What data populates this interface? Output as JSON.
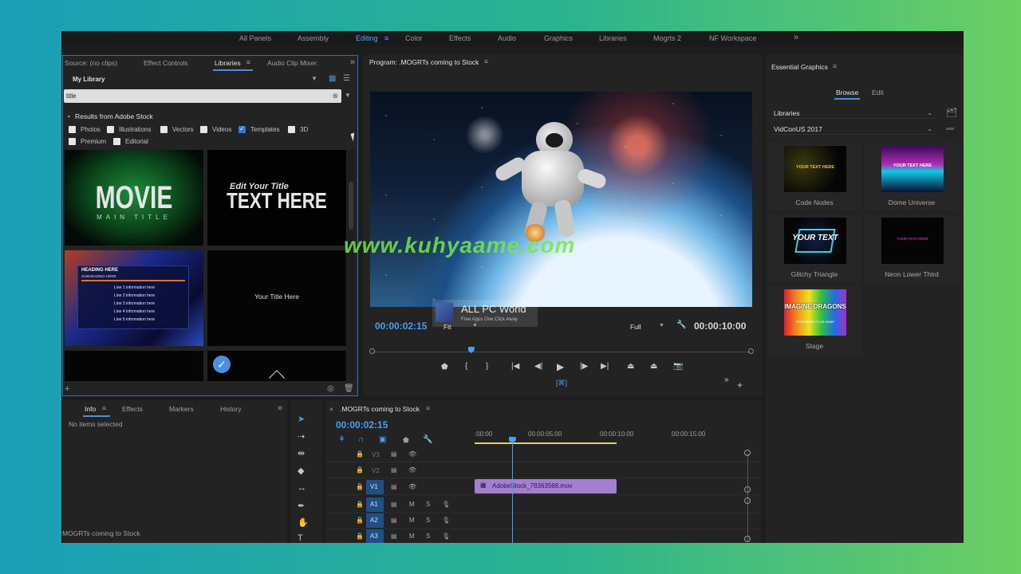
{
  "workspaces": {
    "items": [
      "All Panels",
      "Assembly",
      "Editing",
      "Color",
      "Effects",
      "Audio",
      "Graphics",
      "Libraries",
      "Mogrts 2",
      "NF Workspace"
    ],
    "active": "Editing",
    "more_icon": "chevron-double-right-icon"
  },
  "source_panel": {
    "tabs": [
      "Source: (no clips)",
      "Effect Controls",
      "Libraries",
      "Audio Clip Mixer:"
    ],
    "active_tab": "Libraries",
    "library_select": "My Library",
    "search": {
      "value": "title",
      "placeholder": ""
    },
    "results_header": "Results from Adobe Stock",
    "filters": [
      {
        "label": "Photos",
        "checked": false
      },
      {
        "label": "Illustrations",
        "checked": false
      },
      {
        "label": "Vectors",
        "checked": false
      },
      {
        "label": "Videos",
        "checked": false
      },
      {
        "label": "Templates",
        "checked": true
      },
      {
        "label": "3D",
        "checked": false
      },
      {
        "label": "Premium",
        "checked": false
      },
      {
        "label": "Editorial",
        "checked": false
      }
    ],
    "tiles": {
      "movie_main": "MOVIE",
      "movie_sub": "MAIN TITLE",
      "edit_small": "Edit Your Title",
      "edit_big": "TEXT HERE",
      "heading": "HEADING HERE",
      "subheading": "SUBHEADING HERE",
      "lines": [
        "Line 1 information here",
        "Line 2 information here",
        "Line 3 information here",
        "Line 4 information here",
        "Line 5 information here"
      ],
      "your_title": "Your Title Here"
    }
  },
  "program": {
    "title": "Program: .MOGRTs coming to Stock",
    "timecode_current": "00:00:02:15",
    "fit": "Fit",
    "quality": "Full",
    "timecode_total": "00:00:10:00",
    "playhead_fraction": 0.26
  },
  "essential_graphics": {
    "title": "Essential Graphics",
    "tabs": [
      "Browse",
      "Edit"
    ],
    "active_tab": "Browse",
    "dropdown1": "Libraries",
    "dropdown2": "VidConUS 2017",
    "items": [
      {
        "label": "Code Nodes",
        "thumb": "YOUR TEXT HERE"
      },
      {
        "label": "Dome Universe",
        "thumb": "YOUR TEXT HERE"
      },
      {
        "label": "Glitchy Triangle",
        "thumb": "YOUR TEXT"
      },
      {
        "label": "Neon Lower Third",
        "thumb": "YOUR TEXT HERE"
      },
      {
        "label": "Stage",
        "thumb": "IMAGINE DRAGONS",
        "thumb_sub": "FEATURING YOUR NAME"
      }
    ]
  },
  "info_panel": {
    "tabs": [
      "Info",
      "Effects",
      "Markers",
      "History"
    ],
    "active_tab": "Info",
    "body": "No items selected",
    "footer": "MOGRTs coming to Stock"
  },
  "timeline": {
    "sequence_name": ".MOGRTs coming to Stock",
    "timecode": "00:00:02:15",
    "ruler": [
      ":00:00",
      "00:00:05:00",
      "00:00:10:00",
      "00:00:15:00"
    ],
    "video_tracks": [
      "V3",
      "V2",
      "V1"
    ],
    "audio_tracks": [
      "A1",
      "A2",
      "A3"
    ],
    "clip_name": "AdobeStock_78363568.mov",
    "clip_color": "#a57fcf",
    "playhead_seconds": 2.6
  },
  "overlays": {
    "watermark": "www.kuhyaame.com",
    "allpc": "ALL PC World",
    "allpc_sub": "Free Apps One Click Away"
  }
}
